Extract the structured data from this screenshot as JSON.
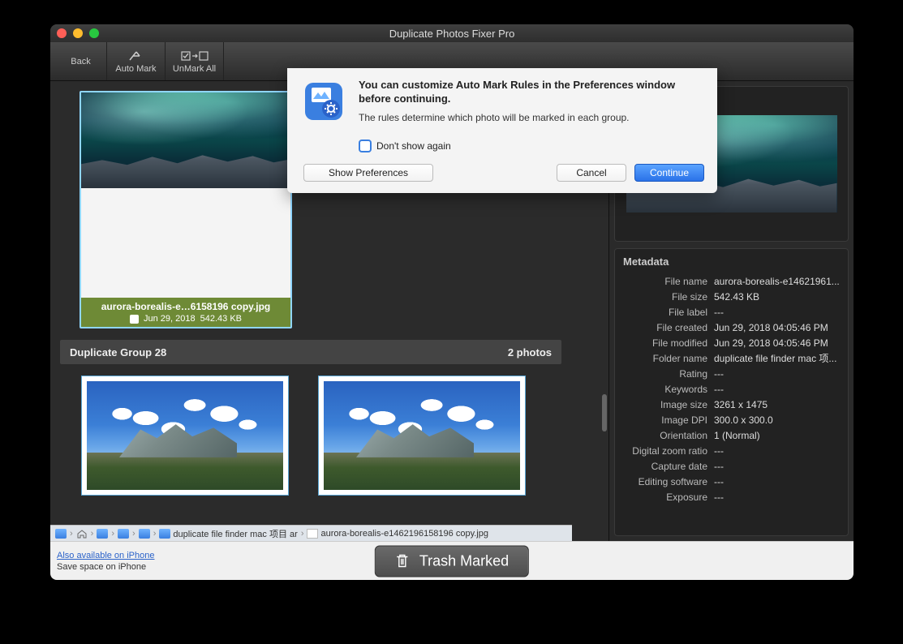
{
  "window_title": "Duplicate Photos Fixer Pro",
  "toolbar": {
    "back": "Back",
    "automark": "Auto Mark",
    "unmarkall": "UnMark All"
  },
  "selected_card": {
    "filename": "aurora-borealis-e…6158196 copy.jpg",
    "date": "Jun 29, 2018",
    "size": "542.43 KB"
  },
  "group": {
    "title": "Duplicate Group 28",
    "count": "2 photos"
  },
  "breadcrumb": {
    "folder": "duplicate file finder mac 项目 ar",
    "file": "aurora-borealis-e1462196158196 copy.jpg"
  },
  "footer": {
    "link_text": "Also available on iPhone",
    "sub_text": "Save space on iPhone",
    "trash": "Trash Marked"
  },
  "metadata": {
    "header": "Metadata",
    "rows": [
      {
        "k": "File name",
        "v": "aurora-borealis-e14621961..."
      },
      {
        "k": "File size",
        "v": "542.43 KB"
      },
      {
        "k": "File label",
        "v": "---"
      },
      {
        "k": "File created",
        "v": "Jun 29, 2018 04:05:46 PM"
      },
      {
        "k": "File modified",
        "v": "Jun 29, 2018 04:05:46 PM"
      },
      {
        "k": "Folder name",
        "v": "duplicate file finder mac 项..."
      },
      {
        "k": "Rating",
        "v": "---"
      },
      {
        "k": "Keywords",
        "v": "---"
      },
      {
        "k": "Image size",
        "v": "3261 x 1475"
      },
      {
        "k": "Image DPI",
        "v": "300.0 x 300.0"
      },
      {
        "k": "Orientation",
        "v": "1 (Normal)"
      },
      {
        "k": "Digital zoom ratio",
        "v": "---"
      },
      {
        "k": "Capture date",
        "v": "---"
      },
      {
        "k": "Editing software",
        "v": "---"
      },
      {
        "k": "Exposure",
        "v": "---"
      }
    ]
  },
  "modal": {
    "bold": "You can customize Auto Mark Rules in the Preferences window before continuing.",
    "info": "The rules determine which photo will be marked in each group.",
    "dontshow": "Don't show again",
    "show_prefs": "Show Preferences",
    "cancel": "Cancel",
    "continue": "Continue"
  }
}
